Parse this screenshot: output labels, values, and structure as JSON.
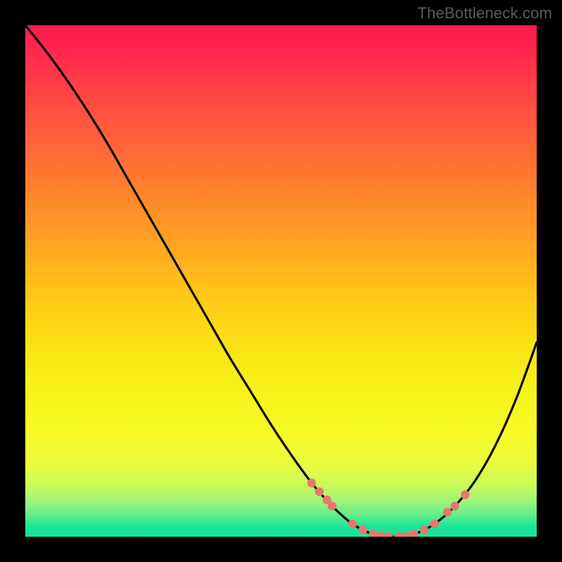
{
  "watermark": "TheBottleneck.com",
  "chart_data": {
    "type": "line",
    "title": "",
    "xlabel": "",
    "ylabel": "",
    "xlim": [
      0,
      100
    ],
    "ylim": [
      0,
      100
    ],
    "grid": false,
    "legend": false,
    "series": [
      {
        "name": "curve",
        "x": [
          0,
          4,
          8,
          12,
          16,
          20,
          24,
          28,
          32,
          36,
          40,
          44,
          48,
          52,
          56,
          60,
          64,
          68,
          72,
          76,
          80,
          84,
          88,
          92,
          96,
          100
        ],
        "y": [
          100,
          95,
          89.5,
          83.5,
          77,
          70,
          63,
          56,
          49,
          42,
          35,
          28.5,
          22,
          16,
          10.5,
          6,
          2.5,
          0.5,
          0,
          0.5,
          2.5,
          6,
          11,
          18,
          27,
          38
        ]
      }
    ],
    "markers": [
      {
        "x": 56,
        "y": 10.5
      },
      {
        "x": 57.5,
        "y": 8.8
      },
      {
        "x": 59,
        "y": 7.2
      },
      {
        "x": 60,
        "y": 6
      },
      {
        "x": 64,
        "y": 2.5
      },
      {
        "x": 66,
        "y": 1.3
      },
      {
        "x": 68,
        "y": 0.5
      },
      {
        "x": 69.5,
        "y": 0.2
      },
      {
        "x": 71,
        "y": 0.05
      },
      {
        "x": 73,
        "y": 0.05
      },
      {
        "x": 74.5,
        "y": 0.1
      },
      {
        "x": 76,
        "y": 0.5
      },
      {
        "x": 78,
        "y": 1.3
      },
      {
        "x": 80,
        "y": 2.5
      },
      {
        "x": 82.5,
        "y": 4.8
      },
      {
        "x": 84,
        "y": 6
      },
      {
        "x": 86,
        "y": 8.2
      }
    ],
    "gradient_stops": [
      {
        "pos": 0,
        "color": "#ff1a53"
      },
      {
        "pos": 50,
        "color": "#ffce16"
      },
      {
        "pos": 85,
        "color": "#f6fb28"
      },
      {
        "pos": 100,
        "color": "#12e59f"
      }
    ]
  }
}
